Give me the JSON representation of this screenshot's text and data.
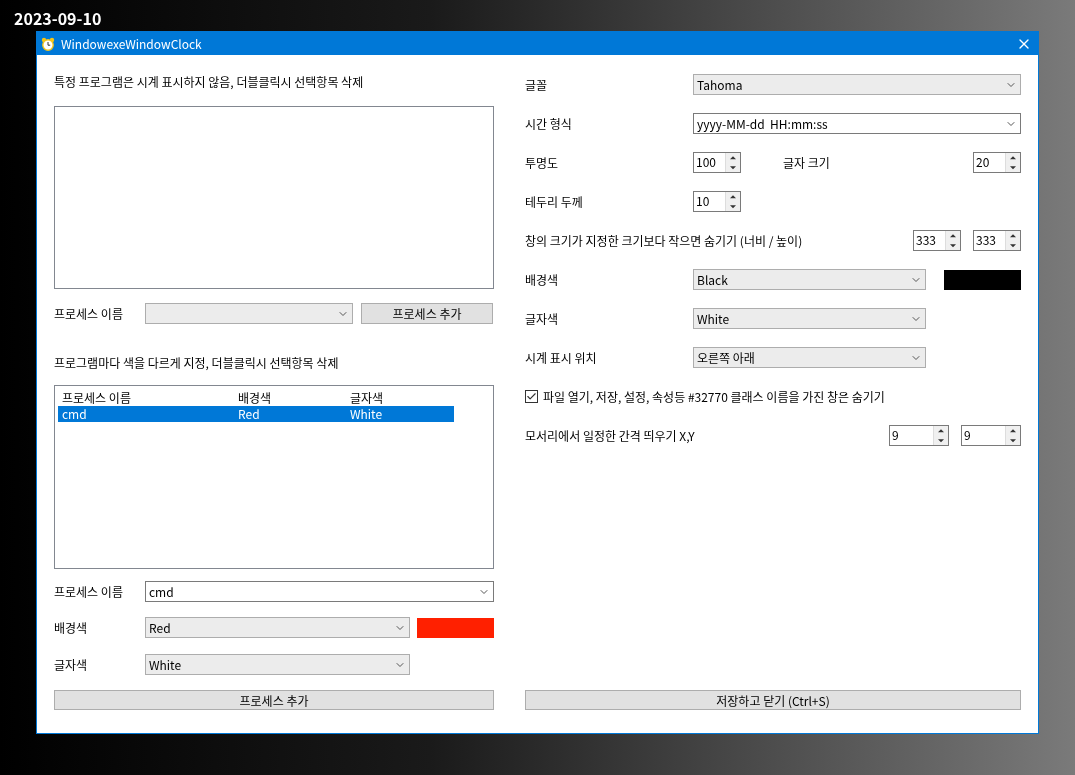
{
  "desktop_clock": "2023-09-10",
  "window": {
    "title": "WindowexeWindowClock"
  },
  "exclude_section": {
    "heading": "특정 프로그램은 시계 표시하지 않음, 더블클릭시 선택항목 삭제",
    "process_label": "프로세스 이름",
    "add_button": "프로세스 추가"
  },
  "color_section": {
    "heading": "프로그램마다 색을 다르게 지정, 더블클릭시 선택항목 삭제",
    "columns": [
      "프로세스 이름",
      "배경색",
      "글자색"
    ],
    "rows": [
      {
        "cells": [
          "cmd",
          "Red",
          "White"
        ],
        "selected": true
      }
    ],
    "fields": [
      {
        "label": "프로세스 이름",
        "value": "cmd"
      },
      {
        "label": "배경색",
        "value": "Red",
        "color": "#ff2000"
      },
      {
        "label": "글자색",
        "value": "White"
      }
    ],
    "add_button": "프로세스 추가"
  },
  "settings": [
    {
      "kind": "combo",
      "label": "글꼴",
      "value": "Tahoma"
    },
    {
      "kind": "text_combo",
      "label": "시간 형식",
      "value": "yyyy-MM-dd  HH:mm:ss"
    },
    {
      "kind": "spin",
      "label": "투명도",
      "value": "100",
      "side_label": "글자 크기",
      "side_value": "20"
    },
    {
      "kind": "spin",
      "label": "테두리 두께",
      "value": "10"
    },
    {
      "kind": "spin_pair",
      "label": "창의 크기가 지정한 크기보다 작으면 숨기기 (너비 / 높이)",
      "values": [
        "333",
        "333"
      ]
    },
    {
      "kind": "short_combo",
      "label": "배경색",
      "value": "Black",
      "color": "#000000"
    },
    {
      "kind": "short_combo",
      "label": "글자색",
      "value": "White"
    },
    {
      "kind": "short_combo",
      "label": "시계 표시 위치",
      "value": "오른쪽 아래"
    },
    {
      "kind": "checkbox",
      "label": "파일 열기, 저장, 설정, 속성등 #32770 클래스 이름을 가진 창은 숨기기",
      "checked": true
    },
    {
      "kind": "spin_pair",
      "label": "모서리에서 일정한 간격 띄우기 X,Y",
      "values": [
        "9",
        "9"
      ]
    }
  ],
  "save_button": "저장하고 닫기 (Ctrl+S)"
}
